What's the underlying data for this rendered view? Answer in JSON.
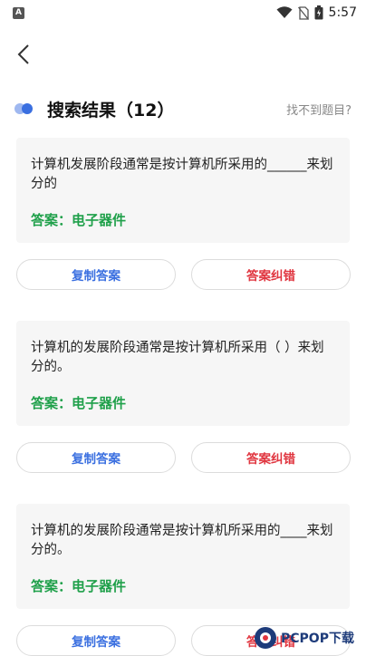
{
  "status_bar": {
    "left_icon_letter": "A",
    "time": "5:57",
    "icons": [
      "wifi-icon",
      "no-sim-icon",
      "battery-icon"
    ]
  },
  "nav": {
    "back_icon": "chevron-left-icon"
  },
  "header": {
    "title": "搜索结果（12）",
    "not_found_link": "找不到题目?"
  },
  "results": [
    {
      "question": "计算机发展阶段通常是按计算机所采用的______来划分的",
      "answer": "答案：电子器件",
      "copy_label": "复制答案",
      "report_label": "答案纠错"
    },
    {
      "question": "计算机的发展阶段通常是按计算机所采用（ ）来划分的。",
      "answer": "答案：电子器件",
      "copy_label": "复制答案",
      "report_label": "答案纠错"
    },
    {
      "question": "计算机的发展阶段通常是按计算机所采用的____来划分的。",
      "answer": "答案：电子器件",
      "copy_label": "复制答案",
      "report_label": "答案纠错"
    }
  ],
  "watermark": {
    "text": "PCPOP下载"
  },
  "colors": {
    "accent_blue": "#3a6fe0",
    "answer_green": "#1fa04a",
    "report_red": "#e0353f",
    "card_bg": "#f6f6f6"
  }
}
